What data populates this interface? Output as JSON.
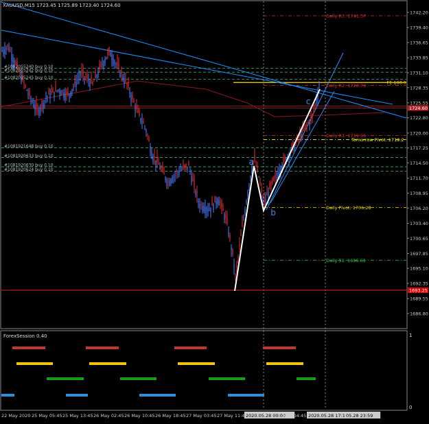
{
  "chart_title": "XAUUSD,M15  1723.45 1725.89 1723.40 1724.60",
  "chart_data": {
    "type": "candlestick",
    "symbol": "XAUUSD",
    "timeframe": "M15",
    "ohlc": {
      "open": 1723.45,
      "high": 1725.89,
      "low": 1723.4,
      "close": 1724.6
    },
    "current_price": "1724.60",
    "low_marker": "1693.25",
    "ylim": [
      1686.0,
      1744.0
    ],
    "y_ticks": [
      "1742.20",
      "1739.40",
      "1736.65",
      "1733.85",
      "1731.10",
      "1728.35",
      "1725.55",
      "1722.80",
      "1720.00",
      "1717.25",
      "1714.50",
      "1711.70",
      "1708.95",
      "1706.20",
      "1703.40",
      "1700.65",
      "1697.85",
      "1695.10",
      "1692.35",
      "1689.55",
      "1686.80"
    ],
    "x_ticks": [
      "22 May 2020",
      "25 May 05:45",
      "25 May 13:45",
      "26 May 02:45",
      "26 May 10:45",
      "26 May 18:45",
      "27 May 03:45",
      "27 May 11:45",
      "2020.05.28 00:00",
      "May 04:45",
      "2020.05.28 17:14",
      "05.28 23:59"
    ],
    "pivots": [
      {
        "label": "Daily R3: 1741.57",
        "value": 1741.57,
        "color": "#e03030"
      },
      {
        "label": "Daily R2: 1728.76",
        "value": 1728.76,
        "color": "#e03030"
      },
      {
        "label": "FE 100.0",
        "value": 1729.3,
        "color": "#ffd700"
      },
      {
        "label": "Daily R1: 1719.55",
        "value": 1719.55,
        "color": "#e03030"
      },
      {
        "label": "Tomorrow Pivot: 1719.2",
        "value": 1718.8,
        "color": "#ffff00"
      },
      {
        "label": "Daily Pivot: 1706.28",
        "value": 1706.28,
        "color": "#ffd700"
      },
      {
        "label": "Daily S1: 1696.61",
        "value": 1696.61,
        "color": "#2ecc40"
      }
    ],
    "orders": [
      {
        "label": "#1082055240 buy 0.10",
        "value": 1731.9
      },
      {
        "label": "#1082055242 buy 0.10",
        "value": 1731.2
      },
      {
        "label": "#1082095245 buy 0.10",
        "value": 1729.9
      },
      {
        "label": "#1081921648 buy 0.10",
        "value": 1717.3
      },
      {
        "label": "#1081920633 buy 0.10",
        "value": 1715.5
      },
      {
        "label": "#1081920630 buy 0.10",
        "value": 1713.8
      },
      {
        "label": "#1081920624 buy 0.10",
        "value": 1713.0
      }
    ],
    "wave_labels": [
      "a",
      "b",
      "c"
    ]
  },
  "subwindow": {
    "title": "ForexSession 0.40",
    "scale_top": "1",
    "scale_bottom": "0",
    "sessions": [
      {
        "name": "red",
        "color": "#c0392b"
      },
      {
        "name": "yellow",
        "color": "#f1c40f"
      },
      {
        "name": "green",
        "color": "#1a9c1a"
      },
      {
        "name": "blue",
        "color": "#2a8fd8"
      }
    ]
  }
}
